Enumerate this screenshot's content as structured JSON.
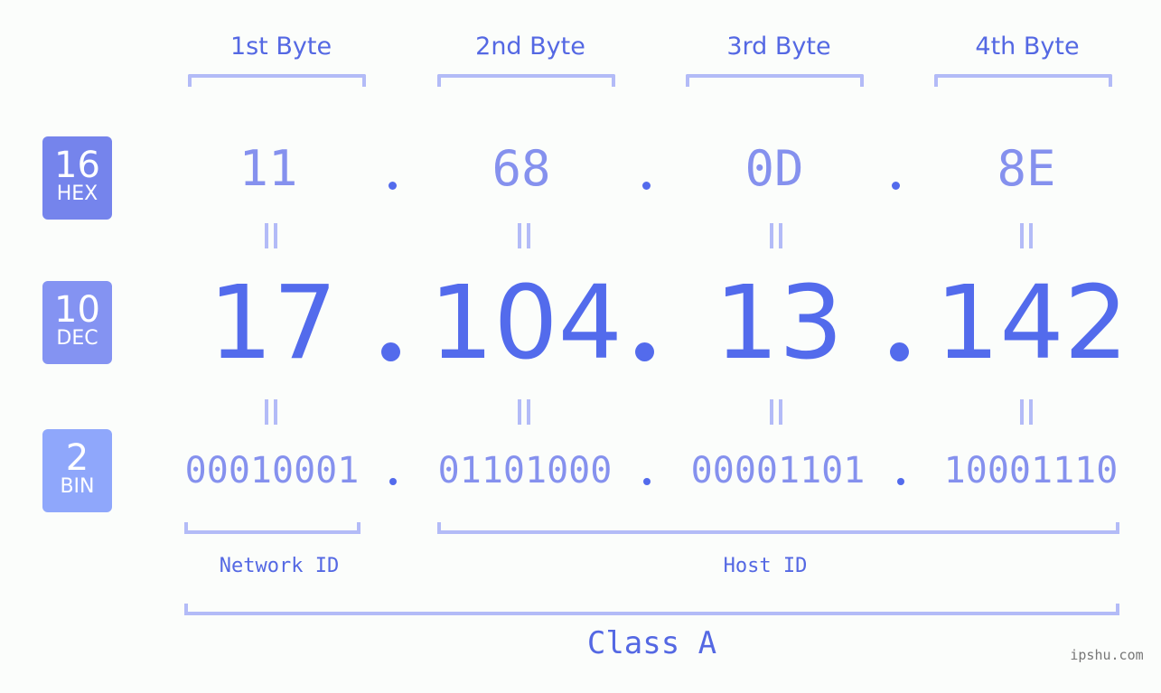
{
  "ip_address": "17.104.13.142",
  "bytes": [
    {
      "label": "1st Byte",
      "hex": "11",
      "dec": "17",
      "bin": "00010001"
    },
    {
      "label": "2nd Byte",
      "hex": "68",
      "dec": "104",
      "bin": "01101000"
    },
    {
      "label": "3rd Byte",
      "hex": "0D",
      "dec": "13",
      "bin": "00001101"
    },
    {
      "label": "4th Byte",
      "hex": "8E",
      "dec": "142",
      "bin": "10001110"
    }
  ],
  "bases": {
    "hex": {
      "num": "16",
      "name": "HEX",
      "color": "#7584ec"
    },
    "dec": {
      "num": "10",
      "name": "DEC",
      "color": "#8493f2"
    },
    "bin": {
      "num": "2",
      "name": "BIN",
      "color": "#8fa7fb"
    }
  },
  "equals_symbol": "=",
  "network_id_label": "Network ID",
  "host_id_label": "Host ID",
  "class_label": "Class A",
  "watermark": "ipshu.com",
  "colors": {
    "accent": "#536bec",
    "light_value": "#8591ee",
    "bracket": "#b3bbf7",
    "label": "#5468e3",
    "background": "#fbfdfb"
  }
}
